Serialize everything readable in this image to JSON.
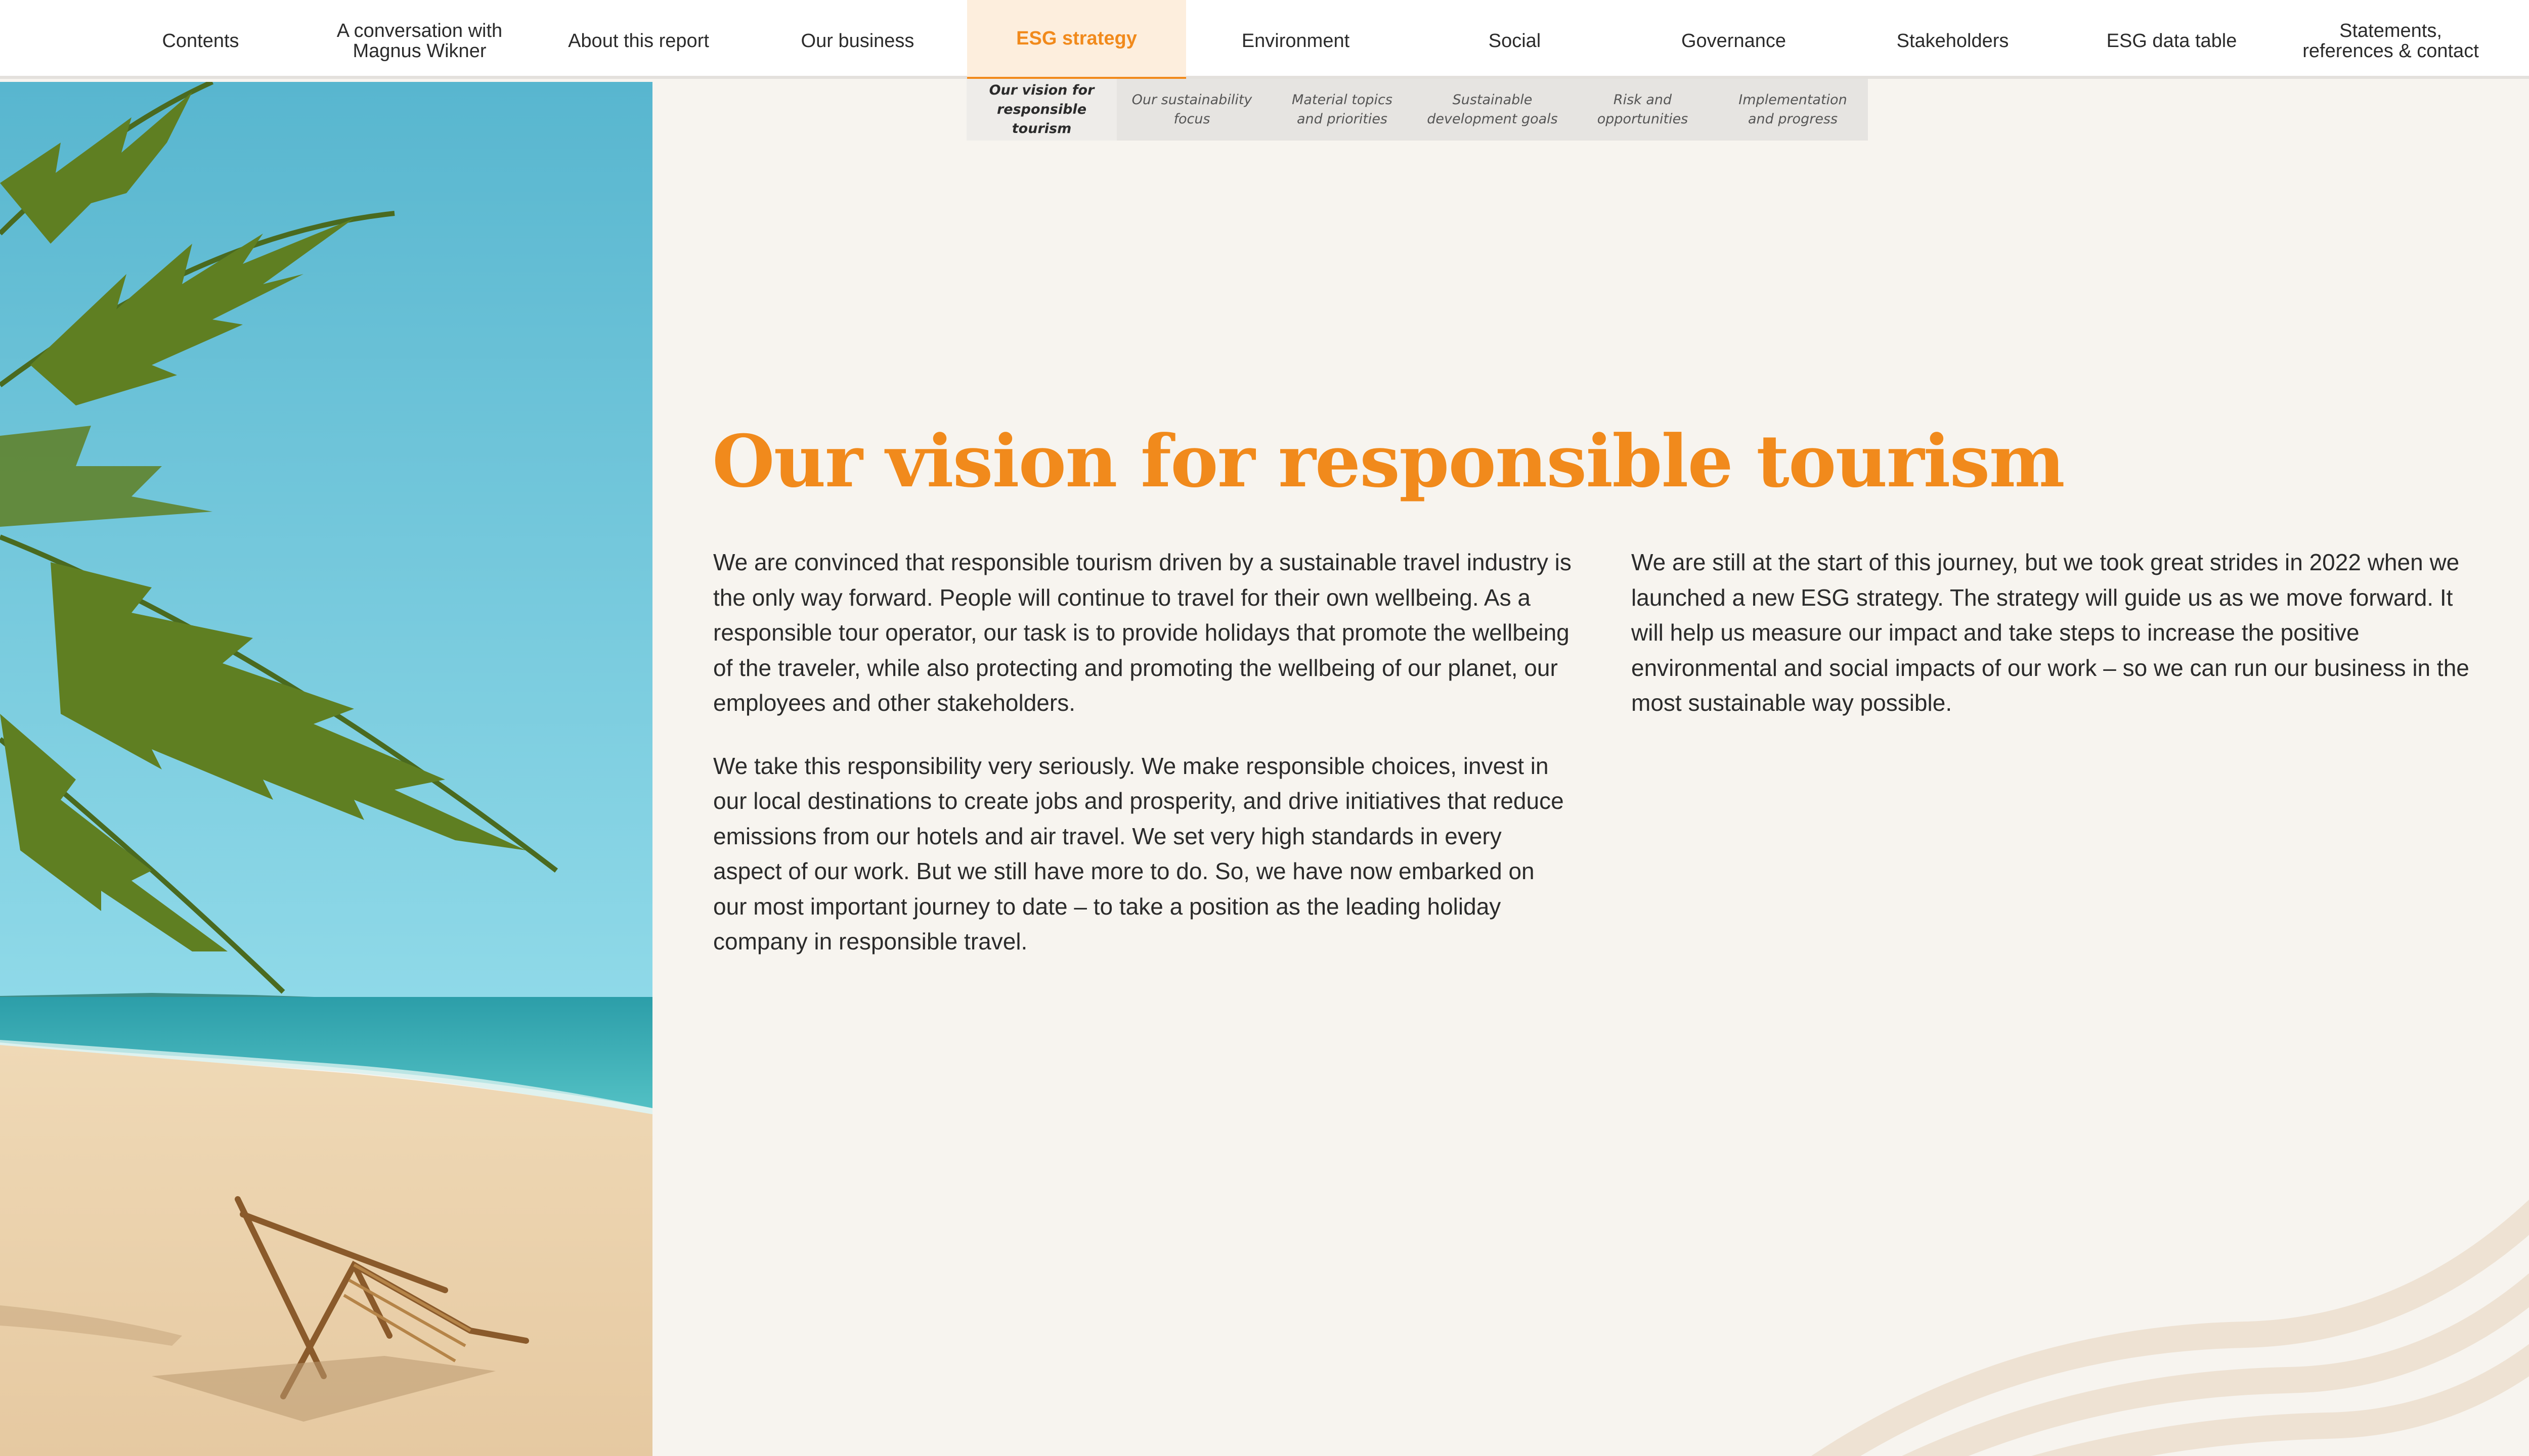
{
  "nav": {
    "items": [
      {
        "label": "Contents"
      },
      {
        "label": "A conversation with\nMagnus Wikner"
      },
      {
        "label": "About this report"
      },
      {
        "label": "Our business"
      },
      {
        "label": "ESG strategy"
      },
      {
        "label": "Environment"
      },
      {
        "label": "Social"
      },
      {
        "label": "Governance"
      },
      {
        "label": "Stakeholders"
      },
      {
        "label": "ESG data table"
      },
      {
        "label": "Statements,\nreferences & contact"
      }
    ],
    "active_index": 4
  },
  "subnav": {
    "items": [
      {
        "label": "Our vision for\nresponsible tourism"
      },
      {
        "label": "Our sustainability\nfocus"
      },
      {
        "label": "Material topics\nand priorities"
      },
      {
        "label": "Sustainable\ndevelopment goals"
      },
      {
        "label": "Risk and\nopportunities"
      },
      {
        "label": "Implementation\nand progress"
      }
    ],
    "active_index": 0
  },
  "page": {
    "title": "Our vision for responsible tourism",
    "left_column": [
      "We are convinced that responsible tourism driven by a sustainable travel industry is the only way forward. People will continue to travel for their own wellbeing. As a responsible tour operator, our task is to provide holidays that promote the wellbeing of the traveler, while also protecting and promoting the wellbeing of our planet, our employees and other stakeholders.",
      "We take this responsibility very seriously. We make responsible choices, invest in our local destinations to create jobs and prosperity, and drive initiatives that reduce emissions from our hotels and air travel. We set very high standards in every aspect of our work. But we still have more to do. So, we have now embarked on our most important journey to date – to take a position as the leading holiday company in responsible travel."
    ],
    "right_column": [
      "We are still at the start of this journey, but we took great strides in 2022 when we launched a new ESG strategy. The strategy will guide us as we move forward. It will help us measure our impact and take steps to increase the positive environmental and social impacts of our work – so we can run our business in the most sustainable way possible."
    ]
  },
  "colors": {
    "accent": "#f18a1c",
    "background": "#f7f4ef",
    "nav_background": "#ffffff",
    "subnav_background": "#e6e4e1",
    "wave": "#eee2d3"
  },
  "hero_image": {
    "description_icon": "beach-palm-chair-image"
  }
}
